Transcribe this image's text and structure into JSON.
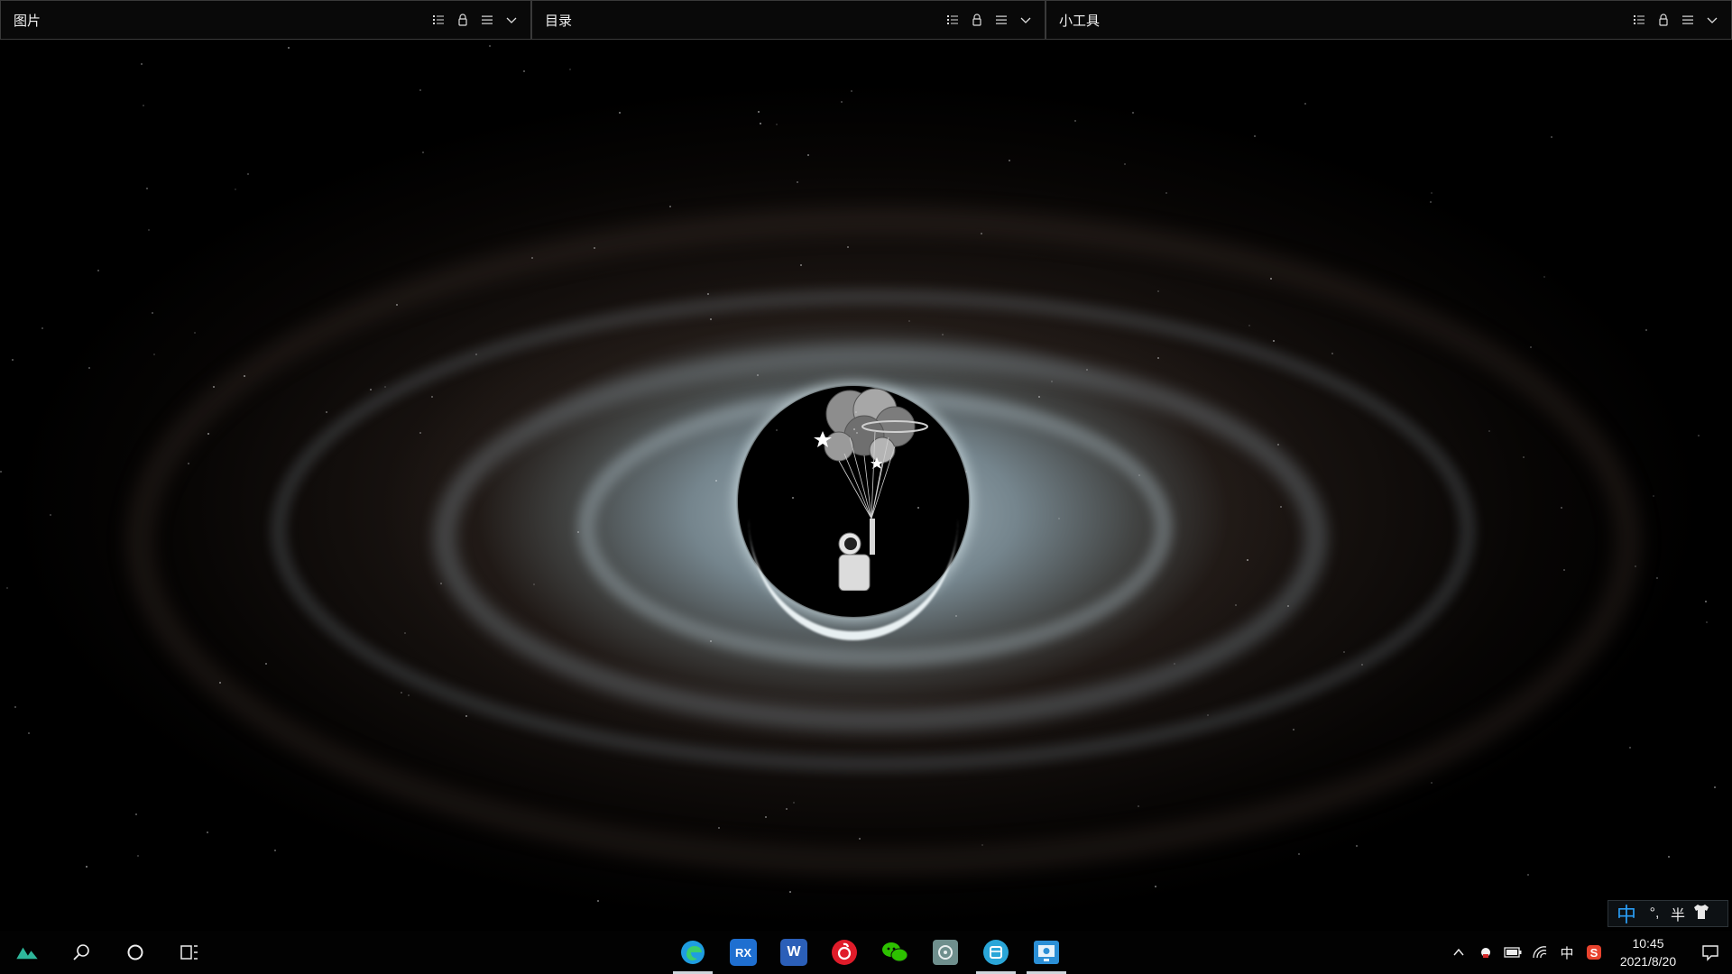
{
  "fences": [
    {
      "title": "图片"
    },
    {
      "title": "目录"
    },
    {
      "title": "小工具"
    }
  ],
  "taskbar": {
    "left_buttons": [
      {
        "icon": "launcher-icon"
      },
      {
        "icon": "search-icon"
      },
      {
        "icon": "cortana-icon"
      },
      {
        "icon": "task-view-icon"
      }
    ],
    "pinned_apps": [
      {
        "icon": "edge-icon",
        "label": "",
        "color": "#1f9de0",
        "active": true
      },
      {
        "icon": "rx-app-icon",
        "label": "RX",
        "color": "#1f6fd0",
        "active": false
      },
      {
        "icon": "word-icon",
        "label": "W",
        "color": "#2b5fb8",
        "active": false
      },
      {
        "icon": "netease-music-icon",
        "label": "",
        "color": "#e01c2a",
        "active": false
      },
      {
        "icon": "wechat-icon",
        "label": "",
        "color": "#2dc100",
        "active": false
      },
      {
        "icon": "settings-tool-icon",
        "label": "",
        "color": "#6f8f8d",
        "active": false
      },
      {
        "icon": "fences-icon",
        "label": "",
        "color": "#2aa6d8",
        "active": true
      },
      {
        "icon": "remote-desktop-icon",
        "label": "",
        "color": "#2b8fd6",
        "active": true
      }
    ],
    "tray": {
      "show_hidden_label": "^",
      "ime_indicator": "中",
      "time": "10:45",
      "date": "2021/8/20"
    }
  },
  "ime_bar": {
    "mode": "中",
    "punct": "°,",
    "width_mode": "半",
    "skin": "shirt-icon"
  },
  "colors": {
    "accent_blue": "#2a9df4",
    "fence_bg": "#0a0a0a"
  }
}
